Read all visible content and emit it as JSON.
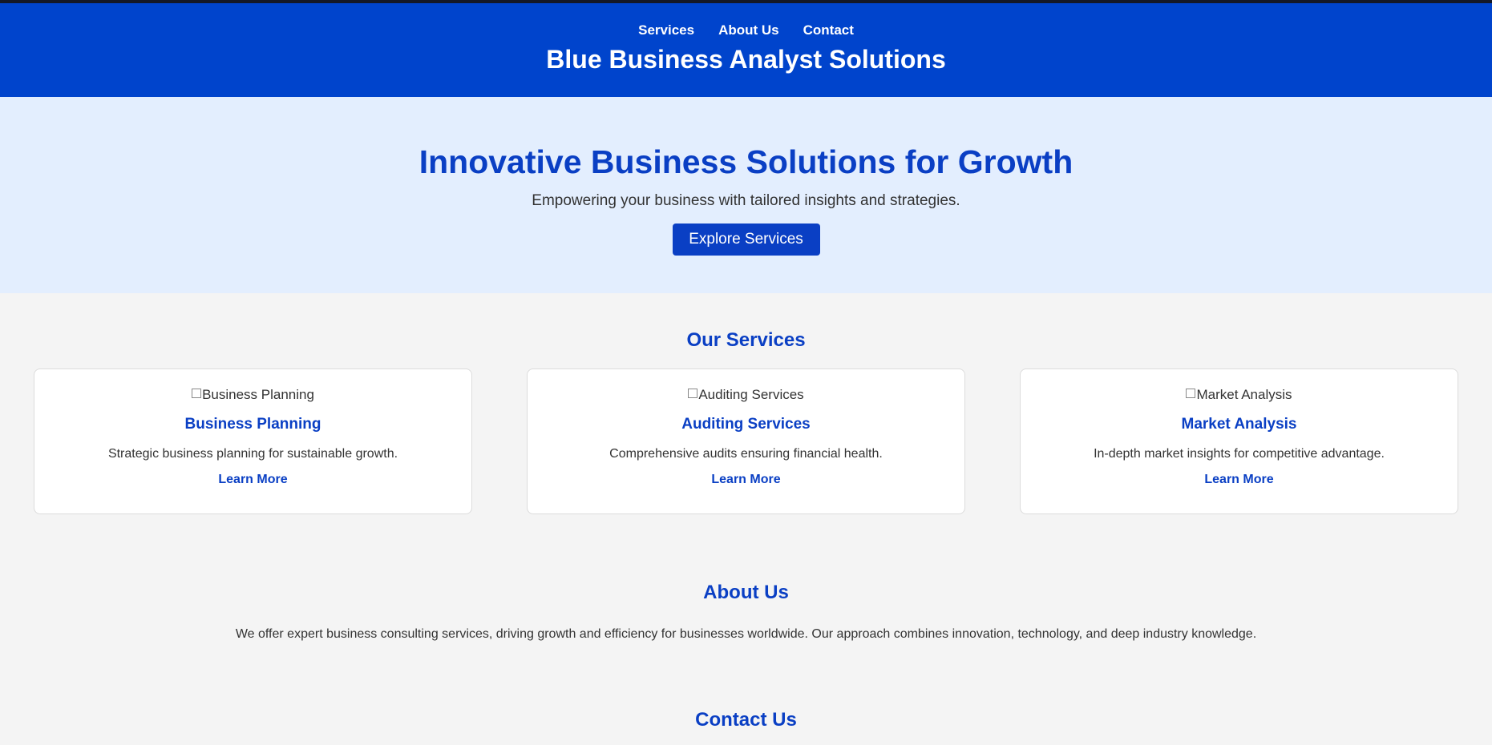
{
  "header": {
    "nav": [
      "Services",
      "About Us",
      "Contact"
    ],
    "title": "Blue Business Analyst Solutions"
  },
  "hero": {
    "heading": "Innovative Business Solutions for Growth",
    "subheading": "Empowering your business with tailored insights and strategies.",
    "cta_label": "Explore Services"
  },
  "services": {
    "title": "Our Services",
    "cards": [
      {
        "image_alt": "Business Planning",
        "title": "Business Planning",
        "description": "Strategic business planning for sustainable growth.",
        "link_label": "Learn More"
      },
      {
        "image_alt": "Auditing Services",
        "title": "Auditing Services",
        "description": "Comprehensive audits ensuring financial health.",
        "link_label": "Learn More"
      },
      {
        "image_alt": "Market Analysis",
        "title": "Market Analysis",
        "description": "In-depth market insights for competitive advantage.",
        "link_label": "Learn More"
      }
    ]
  },
  "about": {
    "title": "About Us",
    "text": "We offer expert business consulting services, driving growth and efficiency for businesses worldwide. Our approach combines innovation, technology, and deep industry knowledge."
  },
  "contact": {
    "title": "Contact Us"
  },
  "colors": {
    "header_bg": "#0044cc",
    "accent": "#0a3fc4",
    "hero_bg": "#e3eefe",
    "page_bg": "#f4f4f4"
  }
}
